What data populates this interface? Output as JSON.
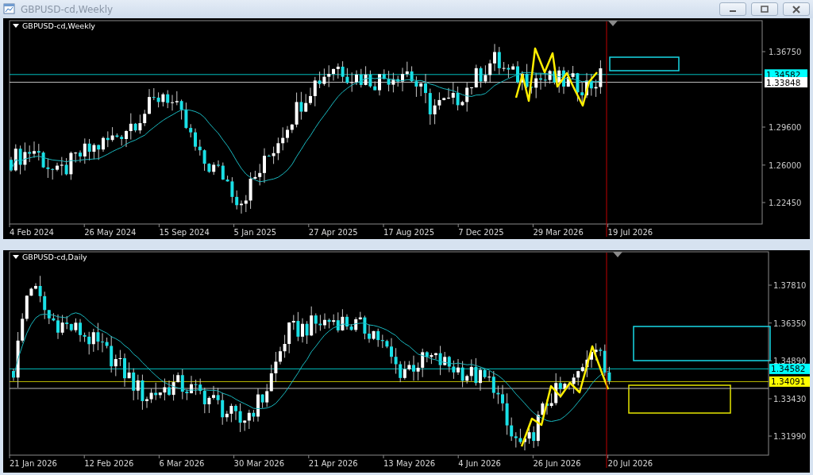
{
  "window": {
    "title": "GBPUSD-cd,Weekly"
  },
  "charts": [
    {
      "title": "GBPUSD-cd,Weekly",
      "price_ticks": [
        "1.36750",
        "1.29600",
        "1.26000",
        "1.22450"
      ],
      "date_ticks": [
        "4 Feb 2024",
        "26 May 2024",
        "15 Sep 2024",
        "5 Jan 2025",
        "27 Apr 2025",
        "17 Aug 2025",
        "7 Dec 2025",
        "29 Mar 2026",
        "19 Jul 2026"
      ],
      "price_tags": [
        {
          "text": "1.34582",
          "color": "#00ffff"
        },
        {
          "text": "1.33848",
          "color": "#ffffff"
        }
      ]
    },
    {
      "title": "GBPUSD-cd,Daily",
      "price_ticks": [
        "1.37810",
        "1.36350",
        "1.34890",
        "1.33430",
        "1.31990"
      ],
      "date_ticks": [
        "21 Jan 2026",
        "12 Feb 2026",
        "6 Mar 2026",
        "30 Mar 2026",
        "21 Apr 2026",
        "13 May 2026",
        "4 Jun 2026",
        "26 Jun 2026",
        "20 Jul 2026"
      ],
      "price_tags": [
        {
          "text": "1.34582",
          "color": "#00ffff"
        },
        {
          "text": "1.34091",
          "color": "#ffff00"
        }
      ]
    }
  ]
}
